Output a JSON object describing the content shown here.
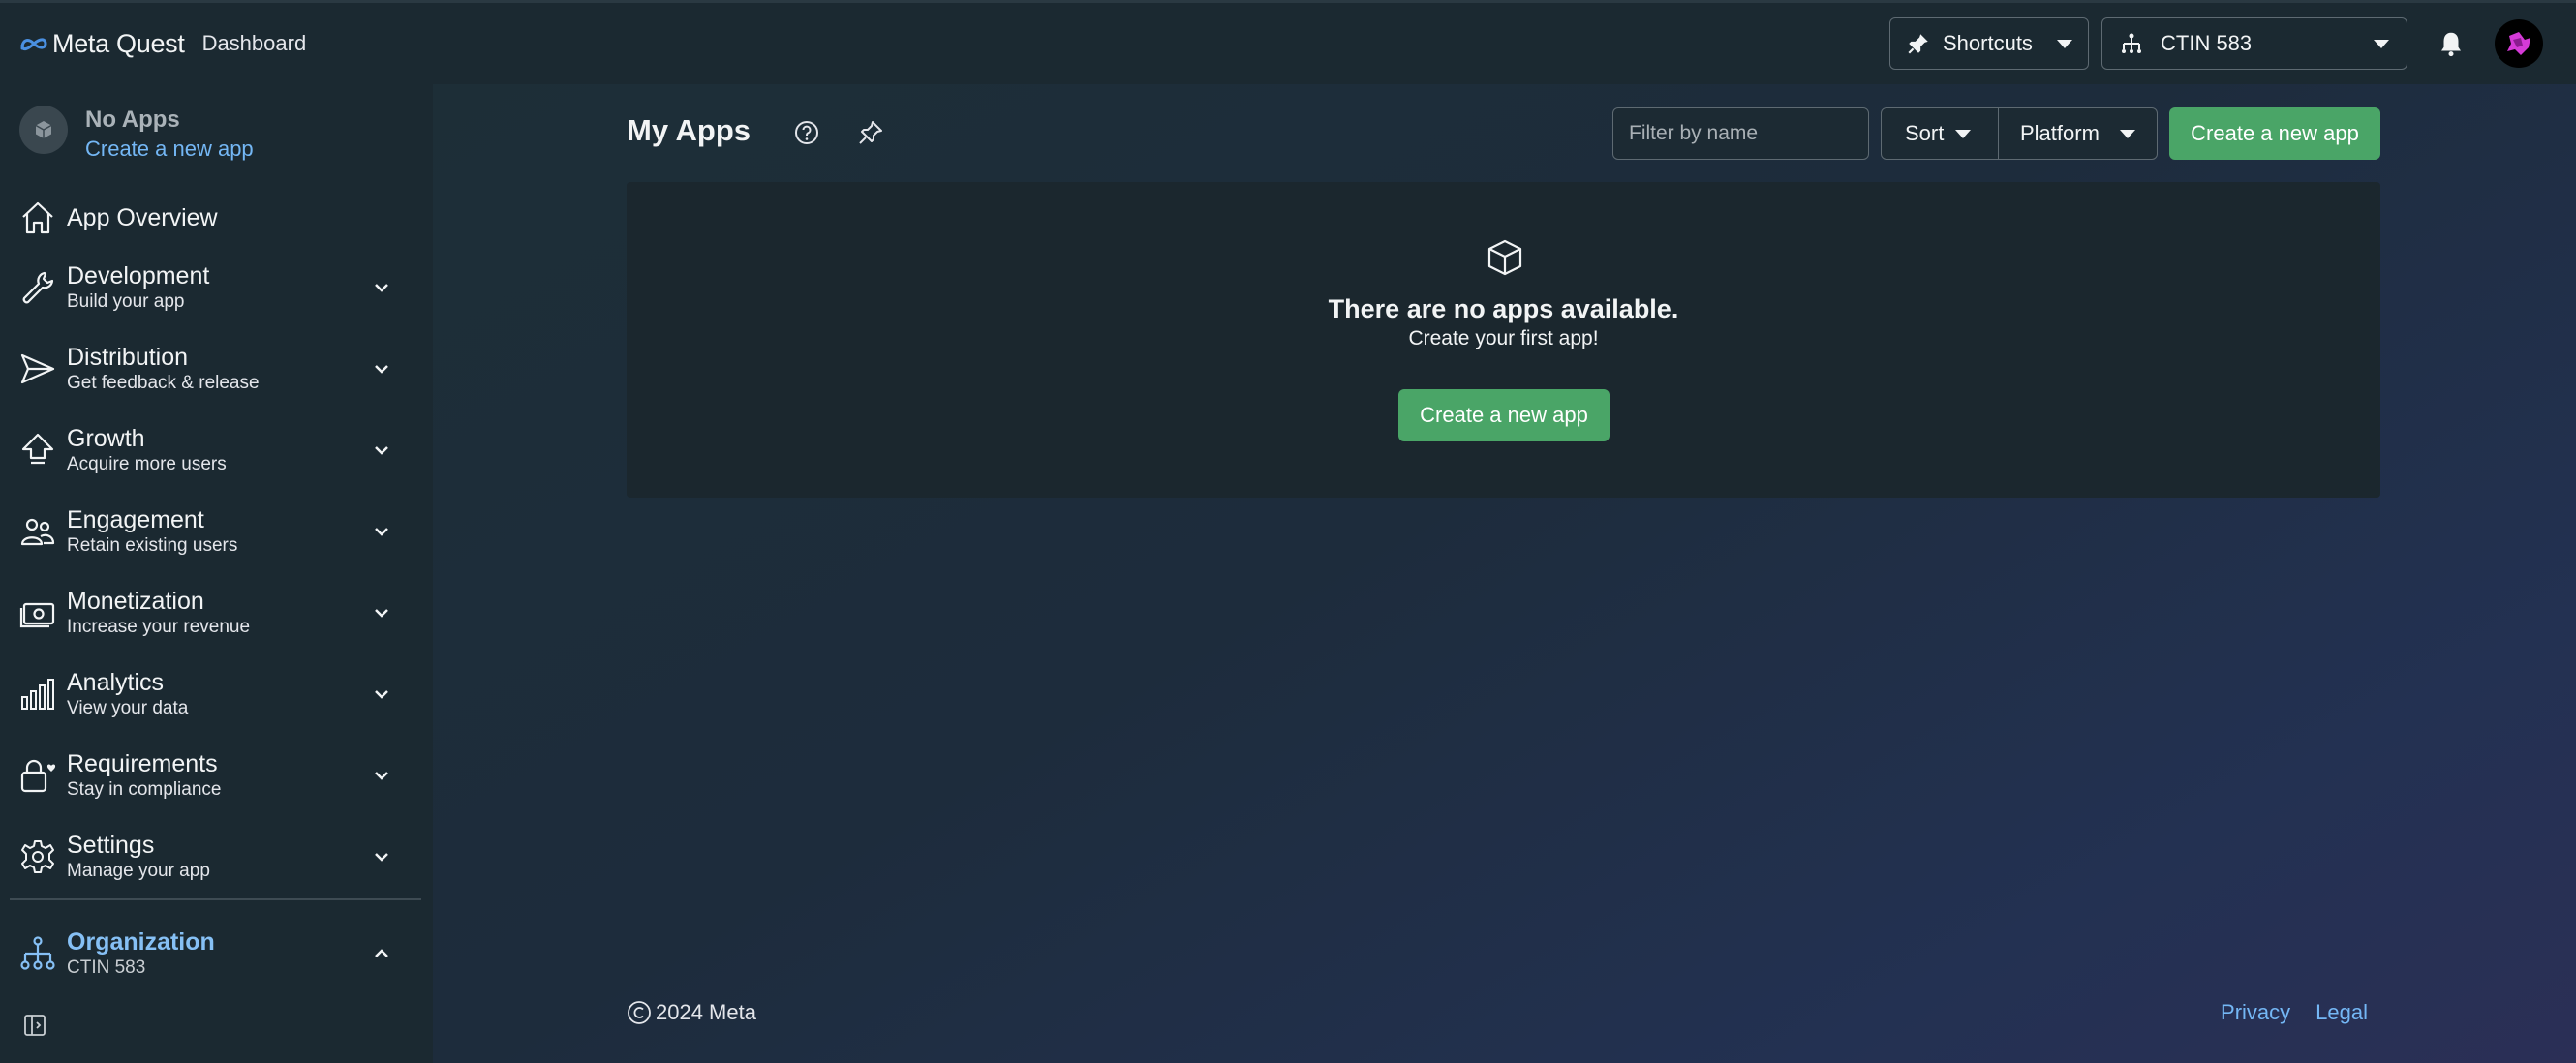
{
  "topbar": {
    "brand": "Meta Quest",
    "section": "Dashboard",
    "shortcuts_label": "Shortcuts",
    "org_selected": "CTIN 583"
  },
  "sidebar": {
    "app_status_title": "No Apps",
    "app_status_link": "Create a new app",
    "items": [
      {
        "title": "App Overview",
        "subtitle": ""
      },
      {
        "title": "Development",
        "subtitle": "Build your app"
      },
      {
        "title": "Distribution",
        "subtitle": "Get feedback & release"
      },
      {
        "title": "Growth",
        "subtitle": "Acquire more users"
      },
      {
        "title": "Engagement",
        "subtitle": "Retain existing users"
      },
      {
        "title": "Monetization",
        "subtitle": "Increase your revenue"
      },
      {
        "title": "Analytics",
        "subtitle": "View your data"
      },
      {
        "title": "Requirements",
        "subtitle": "Stay in compliance"
      },
      {
        "title": "Settings",
        "subtitle": "Manage your app"
      }
    ],
    "organization": {
      "title": "Organization",
      "subtitle": "CTIN 583"
    }
  },
  "main": {
    "title": "My Apps",
    "filter_placeholder": "Filter by name",
    "sort_label": "Sort",
    "platform_label": "Platform",
    "create_label": "Create a new app",
    "empty_title": "There are no apps available.",
    "empty_subtitle": "Create your first app!",
    "empty_create_label": "Create a new app"
  },
  "footer": {
    "copyright": "2024 Meta",
    "privacy": "Privacy",
    "legal": "Legal"
  },
  "colors": {
    "accent_green": "#4aa567",
    "link_blue": "#74b7f5",
    "sidebar_bg": "#1b2931",
    "card_bg": "#1b272e"
  }
}
